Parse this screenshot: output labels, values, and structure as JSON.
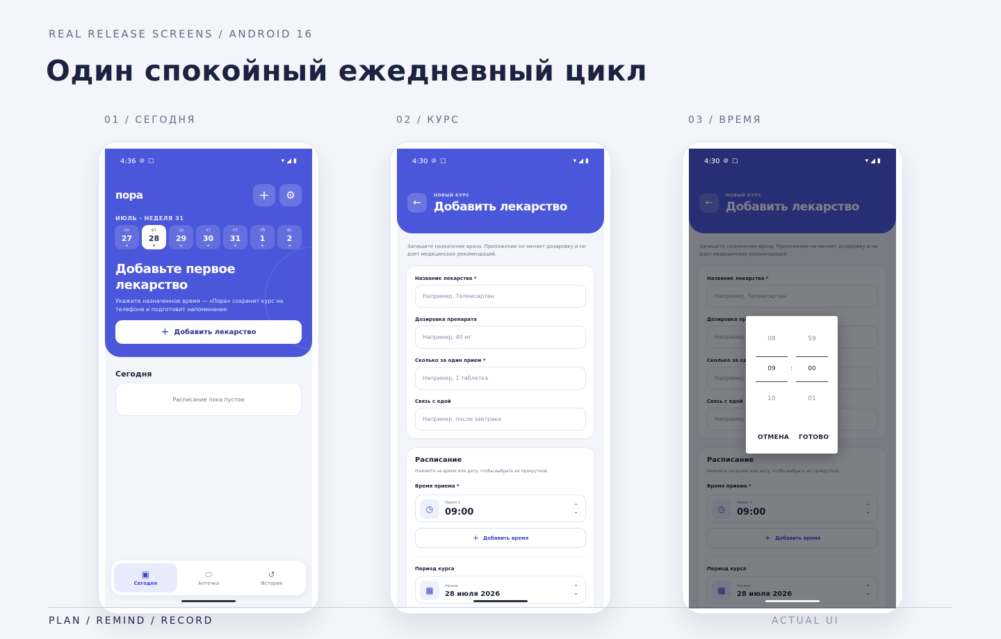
{
  "page": {
    "kicker": "REAL RELEASE SCREENS / ANDROID 16",
    "title": "Один спокойный ежедневный цикл",
    "footer_left": "PLAN / REMIND / RECORD",
    "footer_right": "ACTUAL UI",
    "columns": [
      "01 / СЕГОДНЯ",
      "02 / КУРС",
      "03 / ВРЕМЯ"
    ]
  },
  "screen1": {
    "status_time": "4:36",
    "brand": "пора",
    "week_label": "ИЮЛЬ · НЕДЕЛЯ 31",
    "days": [
      {
        "dn": "пн",
        "dd": "27"
      },
      {
        "dn": "вт",
        "dd": "28"
      },
      {
        "dn": "ср",
        "dd": "29"
      },
      {
        "dn": "чт",
        "dd": "30"
      },
      {
        "dn": "пт",
        "dd": "31"
      },
      {
        "dn": "сб",
        "dd": "1"
      },
      {
        "dn": "вс",
        "dd": "2"
      }
    ],
    "hero_title": "Добавьте первое лекарство",
    "hero_sub": "Укажите назначенное время — «Пора» сохранит курс на телефоне и подготовит напоминания.",
    "cta": "Добавить лекарство",
    "section_title": "Сегодня",
    "empty": "Расписание пока пустое",
    "nav": [
      "Сегодня",
      "Аптечка",
      "История"
    ]
  },
  "form": {
    "status_time": "4:30",
    "kicker": "НОВЫЙ КУРС",
    "title": "Добавить лекарство",
    "note": "Запишите назначение врача. Приложение не меняет дозировку и не дает медицинских рекомендаций.",
    "fields": [
      {
        "label": "Название лекарства *",
        "placeholder": "Например, Телмисартан"
      },
      {
        "label": "Дозировка препарата",
        "placeholder": "Например, 40 мг"
      },
      {
        "label": "Сколько за один прием *",
        "placeholder": "Например, 1 таблетка"
      },
      {
        "label": "Связь с едой",
        "placeholder": "Например, после завтрака"
      }
    ],
    "schedule_title": "Расписание",
    "schedule_sub": "Нажмите на время или дату, чтобы выбрать их прокруткой.",
    "time_label": "Время приема *",
    "dose_label": "Прием 1",
    "dose_time": "09:00",
    "add_time": "Добавить время",
    "period_label": "Период курса",
    "start_label": "Начало",
    "start_date": "28 июля 2026"
  },
  "picker": {
    "hours": [
      "08",
      "09",
      "10"
    ],
    "minutes": [
      "59",
      "00",
      "01"
    ],
    "cancel": "ОТМЕНА",
    "done": "ГОТОВО"
  },
  "colors": {
    "accent": "#4b57da",
    "background": "#f3f5fa"
  }
}
